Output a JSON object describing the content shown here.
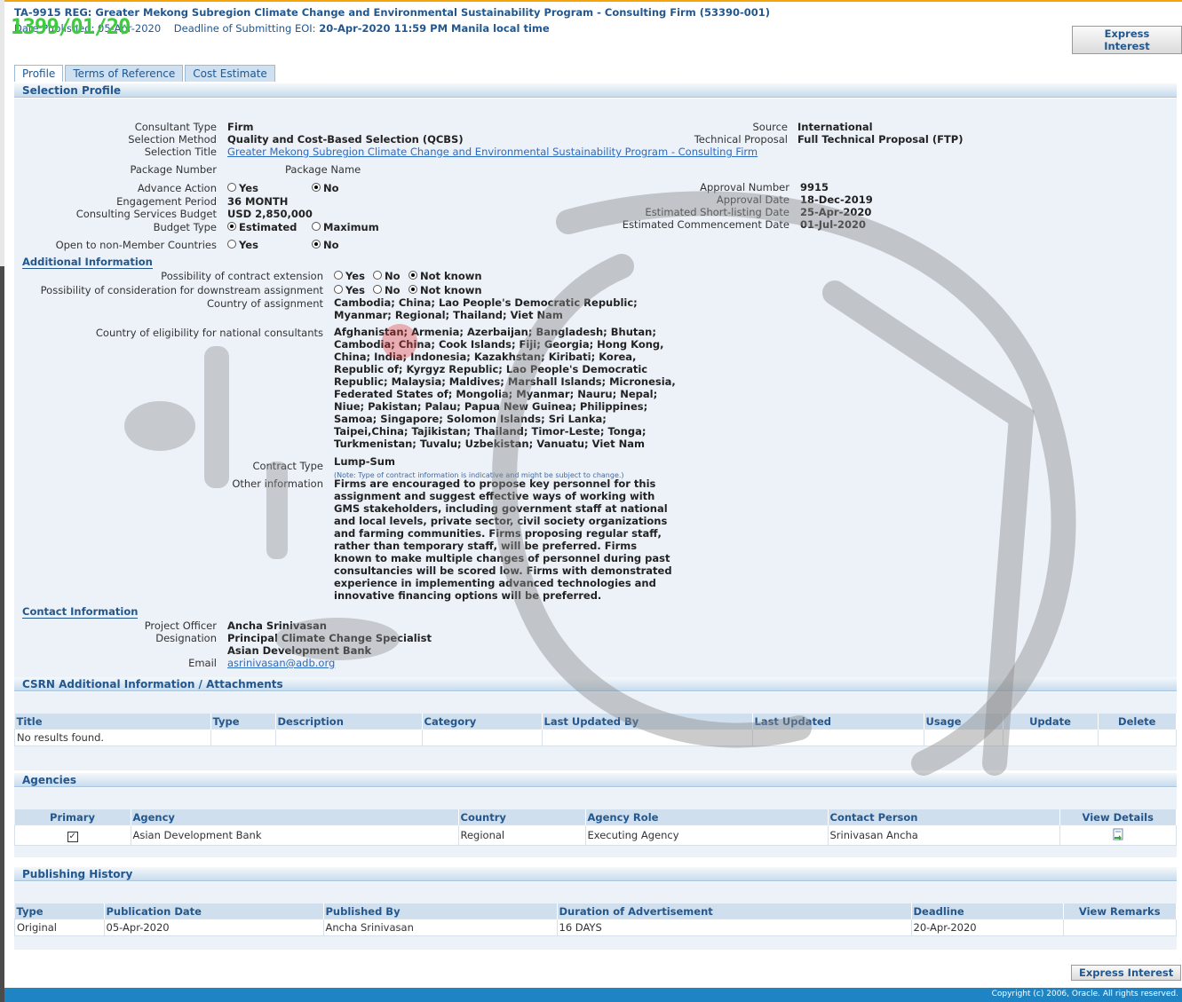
{
  "header": {
    "title": "TA-9915 REG: Greater Mekong Subregion Climate Change and Environmental Sustainability Program - Consulting Firm (53390-001)",
    "published_label": "Date Published: 05-Apr-2020",
    "deadline_label": "Deadline of Submitting EOI:",
    "deadline_value": "20-Apr-2020 11:59 PM Manila local time",
    "stamp": "1399/01/20",
    "express_interest": "Express Interest"
  },
  "tabs": [
    "Profile",
    "Terms of Reference",
    "Cost Estimate"
  ],
  "sections": {
    "selection_profile": "Selection Profile",
    "additional_info": "Additional Information",
    "contact_info": "Contact Information",
    "attachments": "CSRN Additional Information / Attachments",
    "agencies": "Agencies",
    "publishing_history": "Publishing History"
  },
  "profile": {
    "consultant_type_label": "Consultant Type",
    "consultant_type": "Firm",
    "selection_method_label": "Selection Method",
    "selection_method": "Quality and Cost-Based Selection (QCBS)",
    "selection_title_label": "Selection Title",
    "selection_title": "Greater Mekong Subregion Climate Change and Environmental Sustainability Program - Consulting Firm",
    "package_number_label": "Package Number",
    "package_name_label": "Package Name",
    "advance_action_label": "Advance Action",
    "yes": "Yes",
    "no": "No",
    "engagement_period_label": "Engagement Period",
    "engagement_period": "36 MONTH",
    "budget_label": "Consulting Services Budget",
    "budget": "USD 2,850,000",
    "budget_type_label": "Budget Type",
    "estimated": "Estimated",
    "maximum": "Maximum",
    "open_label": "Open to non-Member Countries",
    "source_label": "Source",
    "source": "International",
    "technical_proposal_label": "Technical Proposal",
    "technical_proposal": "Full Technical Proposal (FTP)",
    "approval_number_label": "Approval Number",
    "approval_number": "9915",
    "approval_date_label": "Approval Date",
    "approval_date": "18-Dec-2019",
    "shortlisting_label": "Estimated Short-listing Date",
    "shortlisting": "25-Apr-2020",
    "commencement_label": "Estimated Commencement Date",
    "commencement": "01-Jul-2020"
  },
  "additional": {
    "extension_label": "Possibility of contract extension",
    "downstream_label": "Possibility of consideration for downstream assignment",
    "not_known": "Not known",
    "country_assignment_label": "Country of assignment",
    "country_assignment": "Cambodia; China; Lao People's Democratic Republic; Myanmar; Regional; Thailand; Viet Nam",
    "eligibility_label": "Country of eligibility for national consultants",
    "eligibility": "Afghanistan; Armenia; Azerbaijan; Bangladesh; Bhutan; Cambodia; China; Cook Islands; Fiji; Georgia; Hong Kong, China; India; Indonesia; Kazakhstan; Kiribati; Korea, Republic of; Kyrgyz Republic; Lao People's Democratic Republic; Malaysia; Maldives; Marshall Islands; Micronesia, Federated States of; Mongolia; Myanmar; Nauru; Nepal; Niue; Pakistan; Palau; Papua New Guinea; Philippines; Samoa; Singapore; Solomon Islands; Sri Lanka; Taipei,China; Tajikistan; Thailand; Timor-Leste; Tonga; Turkmenistan; Tuvalu; Uzbekistan; Vanuatu; Viet Nam",
    "contract_type_label": "Contract Type",
    "contract_type": "Lump-Sum",
    "contract_note": "(Note: Type of contract information is indicative and might be subject to change.)",
    "other_label": "Other information",
    "other": "Firms are encouraged to propose key personnel for this assignment and suggest effective ways of working with GMS stakeholders, including government staff at national and local levels, private sector, civil society organizations and farming communities. Firms proposing regular staff, rather than temporary staff, will be preferred. Firms known to make multiple changes of personnel during past consultancies will be scored low. Firms with demonstrated experience in implementing advanced technologies and innovative financing options will be preferred."
  },
  "contact": {
    "officer_label": "Project Officer",
    "officer": "Ancha Srinivasan",
    "designation_label": "Designation",
    "designation": "Principal Climate Change Specialist",
    "org": "Asian Development Bank",
    "email_label": "Email",
    "email": "asrinivasan@adb.org"
  },
  "attachments_table": {
    "columns": [
      "Title",
      "Type",
      "Description",
      "Category",
      "Last Updated By",
      "Last Updated",
      "Usage",
      "Update",
      "Delete"
    ],
    "empty": "No results found."
  },
  "agencies_table": {
    "columns": [
      "Primary",
      "Agency",
      "Country",
      "Agency Role",
      "Contact Person",
      "View Details"
    ],
    "rows": [
      [
        "",
        "Asian Development Bank",
        "Regional",
        "Executing Agency",
        "Srinivasan Ancha",
        ""
      ]
    ]
  },
  "history_table": {
    "columns": [
      "Type",
      "Publication Date",
      "Published By",
      "Duration of Advertisement",
      "Deadline",
      "View Remarks"
    ],
    "rows": [
      [
        "Original",
        "05-Apr-2020",
        "Ancha Srinivasan",
        "16 DAYS",
        "20-Apr-2020",
        ""
      ]
    ]
  },
  "footer": {
    "copyright": "Copyright (c) 2006, Oracle. All rights reserved."
  }
}
